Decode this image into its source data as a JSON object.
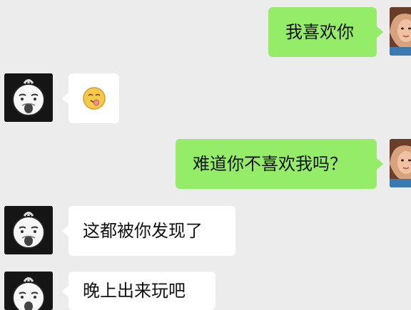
{
  "messages": [
    {
      "side": "right",
      "text": "我喜欢你"
    },
    {
      "side": "left",
      "text": "",
      "emoji": "winking-face-with-tongue-emoji"
    },
    {
      "side": "right",
      "text": "难道你不喜欢我吗？"
    },
    {
      "side": "left",
      "text": "这都被你发现了"
    },
    {
      "side": "left",
      "text": "晚上出来玩吧"
    }
  ],
  "icons": {
    "left_avatar": "cartoon-character-avatar",
    "right_avatar": "user-photo-avatar"
  },
  "colors": {
    "background": "#ececec",
    "sent_bubble": "#95ec69",
    "received_bubble": "#ffffff",
    "avatar_dark": "#151515"
  }
}
